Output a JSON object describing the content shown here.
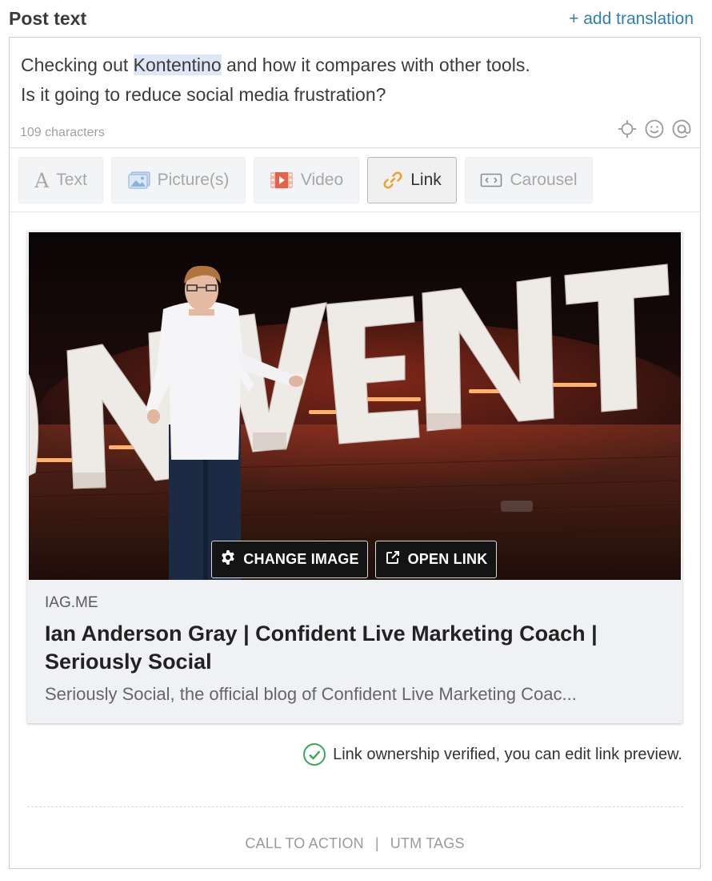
{
  "header": {
    "title": "Post text",
    "add_translation": "+ add translation"
  },
  "post": {
    "line1_before": "Checking out ",
    "highlight": "Kontentino",
    "line1_after": " and how it compares with other tools.",
    "line2": "Is it going to reduce social media frustration?",
    "char_count": "109 characters"
  },
  "toolbar_icons": [
    "crosshair-icon",
    "smiley-icon",
    "at-sign-icon"
  ],
  "post_types": [
    {
      "label": "Text",
      "icon": "text-icon",
      "active": false
    },
    {
      "label": "Picture(s)",
      "icon": "picture-icon",
      "active": false
    },
    {
      "label": "Video",
      "icon": "video-icon",
      "active": false
    },
    {
      "label": "Link",
      "icon": "link-icon",
      "active": true
    },
    {
      "label": "Carousel",
      "icon": "carousel-icon",
      "active": false
    }
  ],
  "preview": {
    "image_letters": "NVENT",
    "change_image": "CHANGE IMAGE",
    "open_link": "OPEN LINK",
    "domain": "IAG.ME",
    "title": "Ian Anderson Gray | Confident Live Marketing Coach | Seriously Social",
    "description": "Seriously Social, the official blog of Confident Live Marketing Coac..."
  },
  "verified": {
    "text": "Link ownership verified, you can edit link preview.",
    "color": "#3aa757"
  },
  "footer": {
    "call_to_action": "CALL TO ACTION",
    "separator": "|",
    "utm_tags": "UTM TAGS"
  },
  "colors": {
    "accent": "#2f7fb5",
    "link_icon": "#f0a030",
    "highlight": "#dde7f7"
  }
}
